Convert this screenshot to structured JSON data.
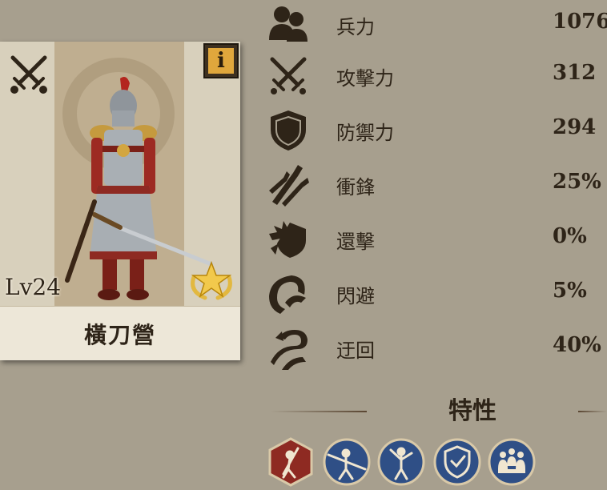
{
  "unit_card": {
    "name": "橫刀營",
    "level": "Lv24",
    "info_label": "i",
    "type_icon": "crossed-swords-icon",
    "rank_icon": "gold-star-laurel-icon"
  },
  "stats": [
    {
      "icon": "troops-icon",
      "label": "兵力",
      "value": "1076"
    },
    {
      "icon": "crossed-swords-icon",
      "label": "攻擊力",
      "value": "312"
    },
    {
      "icon": "shield-icon",
      "label": "防禦力",
      "value": "294"
    },
    {
      "icon": "charge-arrows-icon",
      "label": "衝鋒",
      "value": "25%"
    },
    {
      "icon": "counter-strike-icon",
      "label": "還擊",
      "value": "0%"
    },
    {
      "icon": "evasion-icon",
      "label": "閃避",
      "value": "5%"
    },
    {
      "icon": "flanking-icon",
      "label": "迂回",
      "value": "40%"
    }
  ],
  "traits": {
    "title": "特性",
    "items": [
      {
        "icon": "swordsman-trait-icon",
        "color": "#8e2a22"
      },
      {
        "icon": "charge-breaker-trait-icon",
        "color": "#2f4f86"
      },
      {
        "icon": "warrior-trait-icon",
        "color": "#2f4f86"
      },
      {
        "icon": "shield-formation-trait-icon",
        "color": "#2f4f86"
      },
      {
        "icon": "squad-trait-icon",
        "color": "#2f4f86"
      }
    ]
  },
  "colors": {
    "background": "#a79f8e",
    "text": "#2e2418",
    "info_button": "#e0a73c",
    "icon_dark": "#2e2418"
  }
}
